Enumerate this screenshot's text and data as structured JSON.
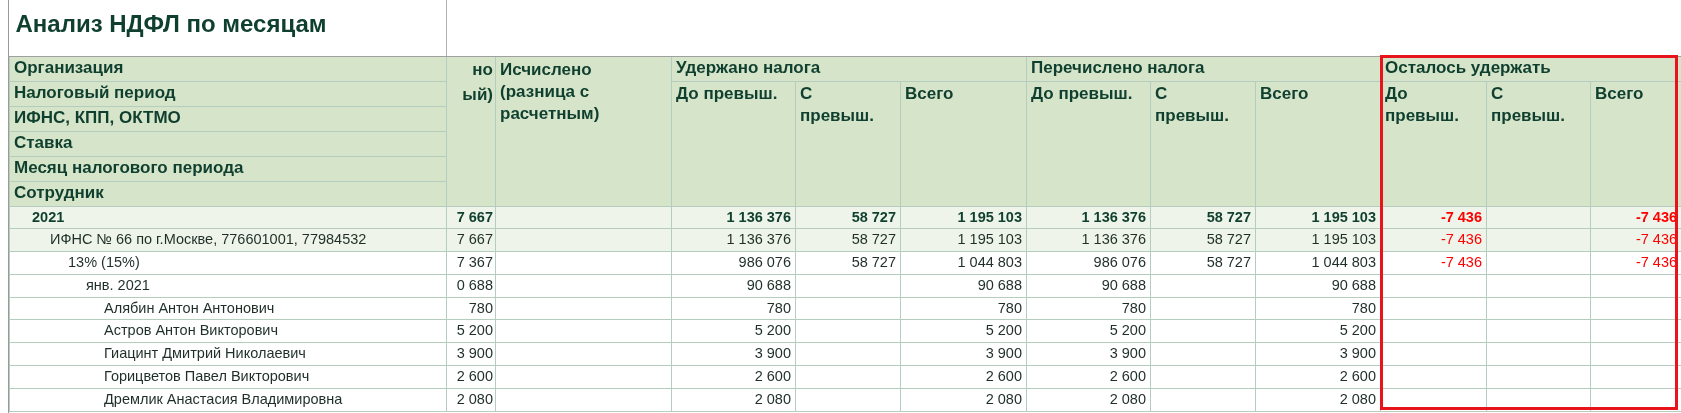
{
  "title": "Анализ НДФЛ по месяцам",
  "dimension_labels": [
    "Организация",
    "Налоговый период",
    "ИФНС, КПП, ОКТМО",
    "Ставка",
    "Месяц налогового периода",
    "Сотрудник"
  ],
  "cut_column_header": [
    "но",
    "ый)"
  ],
  "calculated_header": "Исчислено (разница с расчетным)",
  "column_groups": [
    {
      "title": "Удержано налога",
      "subcolumns": [
        "До превыш.",
        "С превыш.",
        "Всего"
      ]
    },
    {
      "title": "Перечислено налога",
      "subcolumns": [
        "До превыш.",
        "С превыш.",
        "Всего"
      ]
    },
    {
      "title": "Осталось удержать",
      "highlighted": true,
      "subcolumns": [
        "До превыш.",
        "С превыш.",
        "Всего"
      ]
    }
  ],
  "rows": [
    {
      "label": "2021",
      "values": {
        "cut": "7 667",
        "withheld_below": "1 136 376",
        "withheld_above": "58 727",
        "withheld_total": "1 195 103",
        "transferred_below": "1 136 376",
        "transferred_above": "58 727",
        "transferred_total": "1 195 103",
        "remaining_below": "-7 436",
        "remaining_total": "-7 436"
      },
      "children": [
        {
          "label": "ИФНС № 66 по г.Москве, 776601001, 77984532",
          "values": {
            "cut": "7 667",
            "withheld_below": "1 136 376",
            "withheld_above": "58 727",
            "withheld_total": "1 195 103",
            "transferred_below": "1 136 376",
            "transferred_above": "58 727",
            "transferred_total": "1 195 103",
            "remaining_below": "-7 436",
            "remaining_total": "-7 436"
          },
          "children": [
            {
              "label": "13% (15%)",
              "values": {
                "cut": "7 367",
                "withheld_below": "986 076",
                "withheld_above": "58 727",
                "withheld_total": "1 044 803",
                "transferred_below": "986 076",
                "transferred_above": "58 727",
                "transferred_total": "1 044 803",
                "remaining_below": "-7 436",
                "remaining_total": "-7 436"
              },
              "children": [
                {
                  "label": "янв. 2021",
                  "values": {
                    "cut": "0 688",
                    "withheld_below": "90 688",
                    "withheld_total": "90 688",
                    "transferred_below": "90 688",
                    "transferred_total": "90 688"
                  },
                  "children": [
                    {
                      "label": "Алябин Антон Антонович",
                      "values": {
                        "cut": "780",
                        "withheld_below": "780",
                        "withheld_total": "780",
                        "transferred_below": "780",
                        "transferred_total": "780"
                      }
                    },
                    {
                      "label": "Астров Антон Викторович",
                      "values": {
                        "cut": "5 200",
                        "withheld_below": "5 200",
                        "withheld_total": "5 200",
                        "transferred_below": "5 200",
                        "transferred_total": "5 200"
                      }
                    },
                    {
                      "label": "Гиацинт Дмитрий Николаевич",
                      "values": {
                        "cut": "3 900",
                        "withheld_below": "3 900",
                        "withheld_total": "3 900",
                        "transferred_below": "3 900",
                        "transferred_total": "3 900"
                      }
                    },
                    {
                      "label": "Горицветов Павел Викторович",
                      "values": {
                        "cut": "2 600",
                        "withheld_below": "2 600",
                        "withheld_total": "2 600",
                        "transferred_below": "2 600",
                        "transferred_total": "2 600"
                      }
                    },
                    {
                      "label": "Дремлик Анастасия Владимировна",
                      "values": {
                        "cut": "2 080",
                        "withheld_below": "2 080",
                        "withheld_total": "2 080",
                        "transferred_below": "2 080",
                        "transferred_total": "2 080"
                      }
                    }
                  ]
                }
              ]
            }
          ]
        }
      ]
    }
  ]
}
